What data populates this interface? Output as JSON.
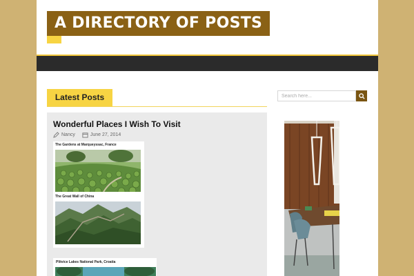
{
  "site": {
    "title": "A DIRECTORY OF POSTS"
  },
  "section": {
    "heading": "Latest Posts"
  },
  "post": {
    "title": "Wonderful Places I Wish To Visit",
    "author": "Nancy",
    "date": "June 27, 2014",
    "captions": [
      "The Gardens at Marqueyssac, France",
      "The Great Wall of China",
      "Plitvice Lakes National Park, Croatia"
    ]
  },
  "search": {
    "placeholder": "Search here..."
  },
  "colors": {
    "background": "#cfb273",
    "brand": "#8a6115",
    "accent": "#f7d443",
    "navbar": "#2b2b2b"
  },
  "icons": {
    "author": "pencil-icon",
    "date": "calendar-icon",
    "search": "search-icon"
  }
}
